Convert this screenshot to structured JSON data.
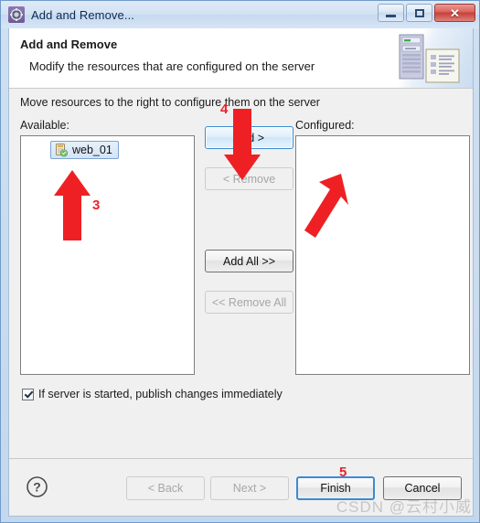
{
  "window": {
    "title": "Add and Remove...",
    "icon": "gear-icon",
    "controls": {
      "minimize": "–",
      "maximize": "□",
      "close": "✕"
    }
  },
  "banner": {
    "title": "Add and Remove",
    "subtitle": "Modify the resources that are configured on the server",
    "icon": "server-and-document-icon"
  },
  "body": {
    "instruction": "Move resources to the right to configure them on the server",
    "available_label": "Available:",
    "configured_label": "Configured:",
    "available_items": [
      {
        "label": "web_01",
        "icon": "web-module-icon",
        "selected": true
      }
    ],
    "configured_items": [],
    "transfer_buttons": [
      {
        "label": "Add >",
        "state": "focused"
      },
      {
        "label": "< Remove",
        "state": "disabled"
      },
      {
        "label": "Add All >>",
        "state": "enabled"
      },
      {
        "label": "<< Remove All",
        "state": "disabled"
      }
    ],
    "publish_checkbox": {
      "label": "If server is started, publish changes immediately",
      "checked": true
    }
  },
  "footer": {
    "help_icon": "help-question-icon",
    "buttons": [
      {
        "label": "< Back",
        "state": "disabled"
      },
      {
        "label": "Next >",
        "state": "disabled"
      },
      {
        "label": "Finish",
        "state": "focused"
      },
      {
        "label": "Cancel",
        "state": "enabled"
      }
    ]
  },
  "annotations": {
    "step3": "3",
    "step4": "4",
    "step5": "5",
    "arrow_color": "#ee2024"
  },
  "watermark": "CSDN @云村小威"
}
